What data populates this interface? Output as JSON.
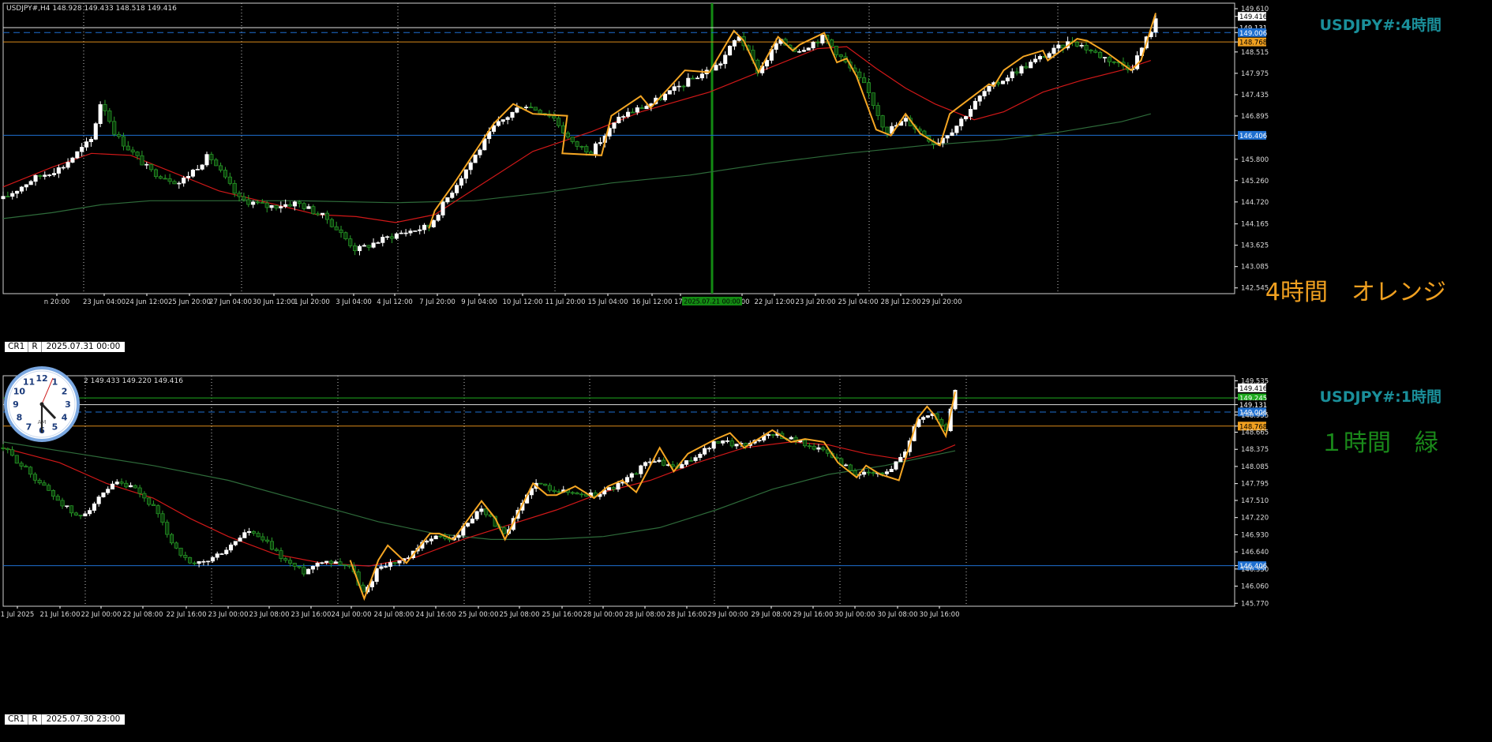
{
  "top_panel": {
    "symbol_info": "USDJPY#,H4  148.928 149.433 148.518 149.416",
    "title": "USDJPY#:4時間",
    "timeframe_label": "4時間　オレンジ",
    "buttons": [
      "CR1",
      "R"
    ],
    "date_box": "2025.07.31 00:00",
    "price_axis": [
      "149.610",
      "149.416",
      "149.131",
      "149.006",
      "148.768",
      "148.515",
      "147.975",
      "147.435",
      "146.895",
      "146.406",
      "145.800",
      "145.260",
      "144.720",
      "144.165",
      "143.625",
      "143.085",
      "142.545"
    ],
    "time_axis": [
      "n 20:00",
      "23 Jun 04:00",
      "24 Jun 12:00",
      "25 Jun 20:00",
      "27 Jun 04:00",
      "30 Jun 12:00",
      "1 Jul 20:00",
      "3 Jul 04:00",
      "4 Jul 12:00",
      "7 Jul 20:00",
      "9 Jul 04:00",
      "10 Jul 12:00",
      "11 Jul 20:00",
      "15 Jul 04:00",
      "16 Jul 12:00",
      "17 J",
      "4:00",
      "22 Jul 12:00",
      "23 Jul 20:00",
      "25 Jul 04:00",
      "28 Jul 12:00",
      "29 Jul 20:00"
    ],
    "vline_label": "2025.07.21 00:00"
  },
  "bottom_panel": {
    "symbol_info": "2 149.433 149.220 149.416",
    "title": "USDJPY#:1時間",
    "timeframe_label": "１時間　緑",
    "buttons": [
      "CR1",
      "R"
    ],
    "date_box": "2025.07.30 23:00",
    "price_axis": [
      "149.535",
      "149.416",
      "149.245",
      "149.131",
      "149.006",
      "148.955",
      "148.768",
      "148.665",
      "148.375",
      "148.085",
      "147.795",
      "147.510",
      "147.220",
      "146.930",
      "146.640",
      "146.406",
      "146.350",
      "146.060",
      "145.770"
    ],
    "time_axis": [
      "1 Jul 2025",
      "21 Jul 16:00",
      "22 Jul 00:00",
      "22 Jul 08:00",
      "22 Jul 16:00",
      "23 Jul 00:00",
      "23 Jul 08:00",
      "23 Jul 16:00",
      "24 Jul 00:00",
      "24 Jul 08:00",
      "24 Jul 16:00",
      "25 Jul 00:00",
      "25 Jul 08:00",
      "25 Jul 16:00",
      "28 Jul 00:00",
      "28 Jul 08:00",
      "28 Jul 16:00",
      "29 Jul 00:00",
      "29 Jul 08:00",
      "29 Jul 16:00",
      "30 Jul 00:00",
      "30 Jul 08:00",
      "30 Jul 16:00"
    ]
  },
  "clock": {
    "numerals": [
      "12",
      "1",
      "2",
      "3",
      "4",
      "5",
      "6",
      "7",
      "8",
      "9",
      "10",
      "11"
    ],
    "ampm": "AM"
  },
  "colors": {
    "background": "#000000",
    "grid": "#c8c8c8",
    "bull_candle": "#ffffff",
    "bear_candle": "#1e8c1e",
    "zigzag": "#f5a623",
    "ma_fast": "#d01818",
    "ma_slow": "#2e6b3a",
    "hline_blue": "#1e6fd0",
    "hline_orange": "#d98a1a",
    "hline_white": "#e0e0e0",
    "hline_green": "#1faa1f",
    "title_teal": "#1a8f9a",
    "label_orange": "#f0a020",
    "label_green": "#1a8a1a",
    "vline_green": "#138a13"
  },
  "chart_data": [
    {
      "type": "candlestick",
      "title": "USDJPY#:4時間",
      "ylim": [
        142.4,
        149.75
      ],
      "zigzag": [
        [
          0.434,
          144.05
        ],
        [
          0.435,
          144.12
        ],
        [
          0.44,
          144.5
        ],
        [
          0.46,
          145.2
        ],
        [
          0.5,
          146.7
        ],
        [
          0.52,
          147.2
        ],
        [
          0.54,
          146.95
        ],
        [
          0.575,
          146.9
        ],
        [
          0.57,
          145.95
        ],
        [
          0.61,
          145.9
        ],
        [
          0.62,
          146.9
        ],
        [
          0.65,
          147.4
        ],
        [
          0.66,
          147.1
        ],
        [
          0.695,
          148.05
        ],
        [
          0.72,
          148.0
        ],
        [
          0.745,
          149.05
        ],
        [
          0.755,
          148.8
        ],
        [
          0.77,
          148.0
        ],
        [
          0.79,
          148.9
        ],
        [
          0.805,
          148.55
        ],
        [
          0.812,
          148.7
        ],
        [
          0.837,
          149.0
        ],
        [
          0.85,
          148.25
        ],
        [
          0.86,
          148.35
        ],
        [
          0.87,
          147.9
        ],
        [
          0.89,
          146.55
        ],
        [
          0.905,
          146.4
        ],
        [
          0.92,
          146.95
        ],
        [
          0.935,
          146.45
        ],
        [
          0.955,
          146.15
        ],
        [
          0.965,
          146.95
        ],
        [
          1.005,
          147.7
        ],
        [
          1.01,
          147.65
        ],
        [
          1.02,
          148.05
        ],
        [
          1.04,
          148.4
        ],
        [
          1.06,
          148.55
        ],
        [
          1.065,
          148.3
        ],
        [
          1.095,
          148.85
        ],
        [
          1.105,
          148.8
        ],
        [
          1.125,
          148.5
        ],
        [
          1.15,
          148.05
        ],
        [
          1.16,
          148.3
        ],
        [
          1.175,
          149.5
        ]
      ],
      "ma_fast": [
        [
          0,
          145.1
        ],
        [
          0.05,
          145.6
        ],
        [
          0.09,
          145.95
        ],
        [
          0.13,
          145.9
        ],
        [
          0.18,
          145.4
        ],
        [
          0.22,
          145.0
        ],
        [
          0.27,
          144.7
        ],
        [
          0.32,
          144.4
        ],
        [
          0.36,
          144.35
        ],
        [
          0.4,
          144.2
        ],
        [
          0.44,
          144.4
        ],
        [
          0.49,
          145.2
        ],
        [
          0.54,
          146.0
        ],
        [
          0.6,
          146.5
        ],
        [
          0.65,
          147.0
        ],
        [
          0.72,
          147.5
        ],
        [
          0.78,
          148.1
        ],
        [
          0.83,
          148.6
        ],
        [
          0.86,
          148.65
        ],
        [
          0.89,
          148.1
        ],
        [
          0.92,
          147.6
        ],
        [
          0.95,
          147.2
        ],
        [
          0.99,
          146.8
        ],
        [
          1.02,
          147.0
        ],
        [
          1.06,
          147.5
        ],
        [
          1.1,
          147.8
        ],
        [
          1.14,
          148.05
        ],
        [
          1.17,
          148.3
        ]
      ],
      "ma_slow": [
        [
          0,
          144.3
        ],
        [
          0.05,
          144.45
        ],
        [
          0.1,
          144.65
        ],
        [
          0.15,
          144.75
        ],
        [
          0.2,
          144.75
        ],
        [
          0.3,
          144.75
        ],
        [
          0.4,
          144.7
        ],
        [
          0.48,
          144.75
        ],
        [
          0.55,
          144.95
        ],
        [
          0.62,
          145.2
        ],
        [
          0.7,
          145.4
        ],
        [
          0.78,
          145.7
        ],
        [
          0.86,
          145.95
        ],
        [
          0.94,
          146.15
        ],
        [
          1.02,
          146.3
        ],
        [
          1.08,
          146.5
        ],
        [
          1.14,
          146.75
        ],
        [
          1.17,
          146.95
        ]
      ],
      "hlines": [
        {
          "price": 149.131,
          "color": "white"
        },
        {
          "price": 149.006,
          "color": "blue",
          "dashed": true
        },
        {
          "price": 148.768,
          "color": "orange"
        },
        {
          "price": 146.406,
          "color": "blue"
        }
      ]
    },
    {
      "type": "candlestick",
      "title": "USDJPY#:1時間",
      "ylim": [
        145.72,
        149.62
      ],
      "zigzag": [
        [
          0.37,
          146.5
        ],
        [
          0.385,
          145.85
        ],
        [
          0.4,
          146.5
        ],
        [
          0.41,
          146.75
        ],
        [
          0.43,
          146.45
        ],
        [
          0.455,
          146.95
        ],
        [
          0.465,
          146.95
        ],
        [
          0.48,
          146.85
        ],
        [
          0.51,
          147.5
        ],
        [
          0.525,
          147.2
        ],
        [
          0.535,
          146.85
        ],
        [
          0.565,
          147.8
        ],
        [
          0.58,
          147.6
        ],
        [
          0.59,
          147.6
        ],
        [
          0.61,
          147.75
        ],
        [
          0.63,
          147.55
        ],
        [
          0.645,
          147.75
        ],
        [
          0.66,
          147.85
        ],
        [
          0.675,
          147.65
        ],
        [
          0.7,
          148.4
        ],
        [
          0.715,
          148.0
        ],
        [
          0.72,
          148.1
        ],
        [
          0.73,
          148.3
        ],
        [
          0.76,
          148.55
        ],
        [
          0.775,
          148.65
        ],
        [
          0.79,
          148.4
        ],
        [
          0.82,
          148.7
        ],
        [
          0.84,
          148.5
        ],
        [
          0.855,
          148.55
        ],
        [
          0.875,
          148.5
        ],
        [
          0.89,
          148.15
        ],
        [
          0.91,
          147.9
        ],
        [
          0.92,
          148.1
        ],
        [
          0.935,
          147.95
        ],
        [
          0.955,
          147.85
        ],
        [
          0.975,
          148.9
        ],
        [
          0.985,
          149.1
        ],
        [
          0.993,
          148.95
        ],
        [
          1.005,
          148.6
        ],
        [
          1.015,
          149.35
        ]
      ],
      "ma_fast": [
        [
          0,
          148.4
        ],
        [
          0.06,
          148.15
        ],
        [
          0.11,
          147.8
        ],
        [
          0.16,
          147.55
        ],
        [
          0.2,
          147.2
        ],
        [
          0.24,
          146.9
        ],
        [
          0.29,
          146.6
        ],
        [
          0.34,
          146.45
        ],
        [
          0.39,
          146.4
        ],
        [
          0.44,
          146.55
        ],
        [
          0.49,
          146.85
        ],
        [
          0.54,
          147.1
        ],
        [
          0.59,
          147.35
        ],
        [
          0.64,
          147.65
        ],
        [
          0.69,
          147.85
        ],
        [
          0.74,
          148.15
        ],
        [
          0.79,
          148.4
        ],
        [
          0.84,
          148.5
        ],
        [
          0.88,
          148.45
        ],
        [
          0.92,
          148.3
        ],
        [
          0.96,
          148.2
        ],
        [
          1.0,
          148.35
        ],
        [
          1.015,
          148.45
        ]
      ],
      "ma_slow": [
        [
          0,
          148.5
        ],
        [
          0.08,
          148.3
        ],
        [
          0.16,
          148.1
        ],
        [
          0.24,
          147.85
        ],
        [
          0.32,
          147.5
        ],
        [
          0.4,
          147.15
        ],
        [
          0.46,
          146.95
        ],
        [
          0.52,
          146.85
        ],
        [
          0.58,
          146.85
        ],
        [
          0.64,
          146.9
        ],
        [
          0.7,
          147.05
        ],
        [
          0.76,
          147.35
        ],
        [
          0.82,
          147.7
        ],
        [
          0.88,
          147.95
        ],
        [
          0.94,
          148.1
        ],
        [
          1.0,
          148.3
        ],
        [
          1.015,
          148.35
        ]
      ],
      "hlines": [
        {
          "price": 149.245,
          "color": "green"
        },
        {
          "price": 149.131,
          "color": "white"
        },
        {
          "price": 149.006,
          "color": "blue",
          "dashed": true
        },
        {
          "price": 148.768,
          "color": "orange"
        },
        {
          "price": 146.406,
          "color": "blue"
        }
      ]
    }
  ]
}
